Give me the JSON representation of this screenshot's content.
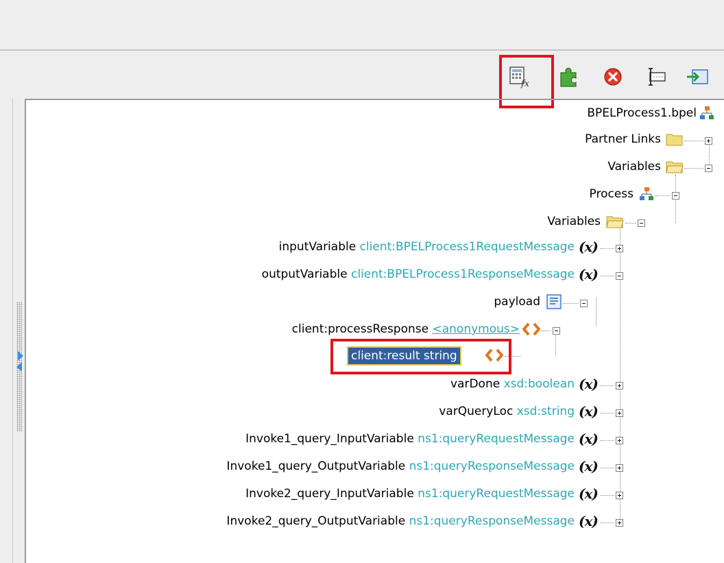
{
  "toolbar": {
    "icons": [
      "expression-builder-icon",
      "puzzle-icon",
      "delete-icon",
      "xpath-icon",
      "import-icon"
    ]
  },
  "tree": {
    "root": "BPELProcess1.bpel",
    "partner_links": "Partner Links",
    "variables_top": "Variables",
    "process": "Process",
    "variables": "Variables",
    "items": [
      {
        "name": "inputVariable",
        "type": "client:BPELProcess1RequestMessage"
      },
      {
        "name": "outputVariable",
        "type": "client:BPELProcess1ResponseMessage"
      },
      {
        "name": "payload",
        "type": ""
      },
      {
        "name": "client:processResponse",
        "type": "<anonymous>"
      },
      {
        "name": "client:result string",
        "type": ""
      },
      {
        "name": "varDone",
        "type": "xsd:boolean"
      },
      {
        "name": "varQueryLoc",
        "type": "xsd:string"
      },
      {
        "name": "Invoke1_query_InputVariable",
        "type": "ns1:queryRequestMessage"
      },
      {
        "name": "Invoke1_query_OutputVariable",
        "type": "ns1:queryResponseMessage"
      },
      {
        "name": "Invoke2_query_InputVariable",
        "type": "ns1:queryRequestMessage"
      },
      {
        "name": "Invoke2_query_OutputVariable",
        "type": "ns1:queryResponseMessage"
      }
    ],
    "var_badge": "(x)"
  },
  "colors": {
    "type_text": "#2aa8b4",
    "highlight": "#e0141e",
    "selection": "#2f5f9e"
  }
}
